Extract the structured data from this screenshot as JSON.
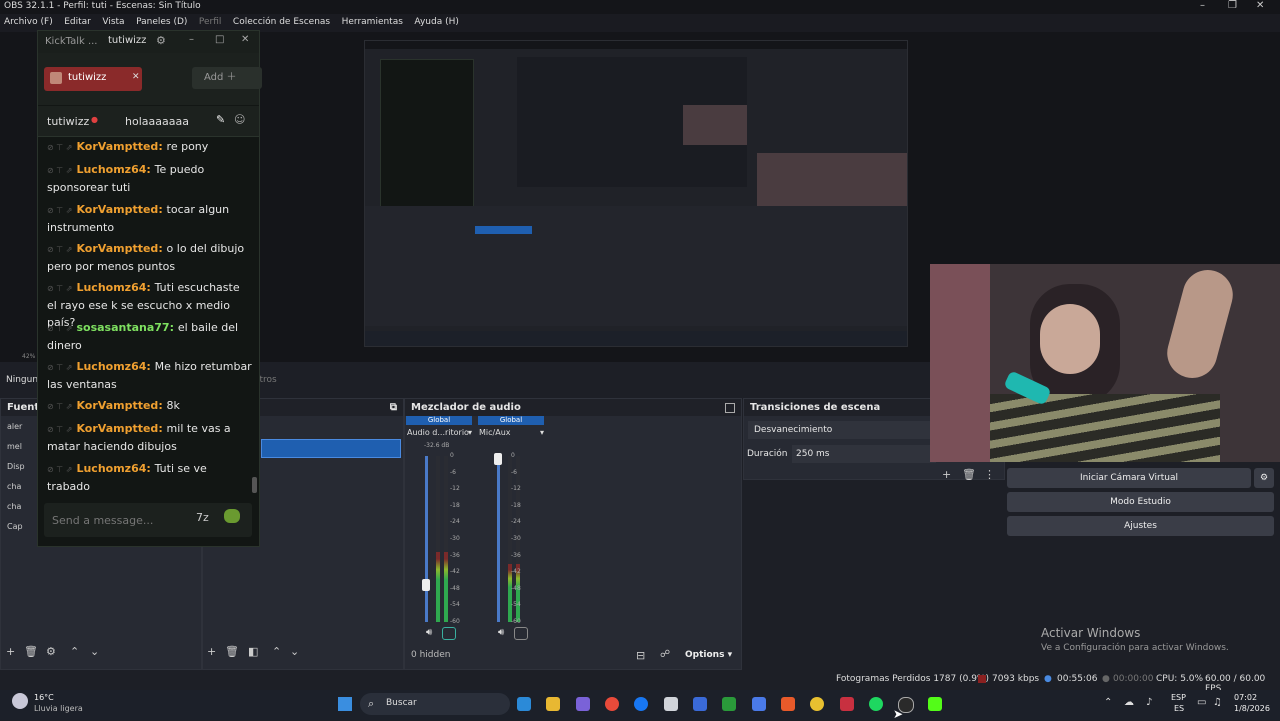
{
  "window": {
    "title": "OBS 32.1.1 - Perfil: tuti - Escenas: Sin Título",
    "controls": [
      "–",
      "❐",
      "✕"
    ]
  },
  "menu": [
    "Archivo (F)",
    "Editar",
    "Vista",
    "Paneles (D)",
    "Perfil",
    "Colección de Escenas",
    "Herramientas",
    "Ayuda (H)"
  ],
  "preview": {
    "zoom": "42%"
  },
  "scenes": {
    "ninguna": "Ningun",
    "filter_label": "Filtros"
  },
  "sources": {
    "title": "Fuentes",
    "items": [
      "aler",
      "mel",
      "Disp",
      "cha",
      "cha",
      "Cap"
    ]
  },
  "scene_transitions": {
    "title": "Transiciones de escena",
    "type": "Desvanecimiento",
    "duration_label": "Duración",
    "duration_value": "250 ms"
  },
  "mixer": {
    "title": "Mezclador de audio",
    "channels": [
      {
        "badge": "Global",
        "name": "Audio d...ritorio",
        "db": "-32.6 dB",
        "level": 0.42,
        "slider": 0.22
      },
      {
        "badge": "Global",
        "name": "Mic/Aux",
        "db": "",
        "level": 0.35,
        "slider": 0.98
      }
    ],
    "ticks": [
      "0",
      "-6",
      "-12",
      "-18",
      "-24",
      "-30",
      "-36",
      "-42",
      "-48",
      "-54",
      "-60"
    ],
    "hidden": "0 hidden",
    "options": "Options"
  },
  "controls": {
    "virtual_cam": "Iniciar Cámara Virtual",
    "studio": "Modo Estudio",
    "settings": "Ajustes"
  },
  "activation": {
    "title": "Activar Windows",
    "sub": "Ve a Configuración para activar Windows."
  },
  "status": {
    "dropped": "Fotogramas Perdidos 1787 (0.9%)",
    "kbps": "7093 kbps",
    "stream_time": "00:55:06",
    "rec_time": "00:00:00",
    "cpu": "CPU: 5.0%",
    "fps": "60.00 / 60.00 FPS"
  },
  "kicktalk": {
    "title": "KickTalk ...",
    "user": "tutiwizz",
    "tab_user": "tutiwizz",
    "add": "Add",
    "channels": [
      "tutiwizz",
      "holaaaaaaa"
    ],
    "messages": [
      {
        "user": "KorVamptted",
        "color": "#f0a030",
        "text": "re pony"
      },
      {
        "user": "Luchomz64",
        "color": "#f0a030",
        "text": "Te puedo sponsorear tuti"
      },
      {
        "user": "KorVamptted",
        "color": "#f0a030",
        "text": "tocar algun instrumento"
      },
      {
        "user": "KorVamptted",
        "color": "#f0a030",
        "text": "o lo del dibujo pero por menos puntos"
      },
      {
        "user": "Luchomz64",
        "color": "#f0a030",
        "text": "Tuti escuchaste el rayo ese k se escucho x medio país?"
      },
      {
        "user": "sosasantana77",
        "color": "#7ee060",
        "text": "el baile del dinero"
      },
      {
        "user": "Luchomz64",
        "color": "#f0a030",
        "text": "Me hizo retumbar las ventanas"
      },
      {
        "user": "KorVamptted",
        "color": "#f0a030",
        "text": "8k"
      },
      {
        "user": "KorVamptted",
        "color": "#f0a030",
        "text": "mil te vas a matar haciendo dibujos"
      },
      {
        "user": "Luchomz64",
        "color": "#f0a030",
        "text": "Tuti se ve trabado"
      }
    ],
    "input_placeholder": "Send a message..."
  },
  "taskbar": {
    "weather_temp": "16°C",
    "weather_desc": "Lluvia ligera",
    "search": "Buscar",
    "lang1": "ESP",
    "lang2": "ES",
    "time": "07:02",
    "date": "1/8/2026"
  }
}
